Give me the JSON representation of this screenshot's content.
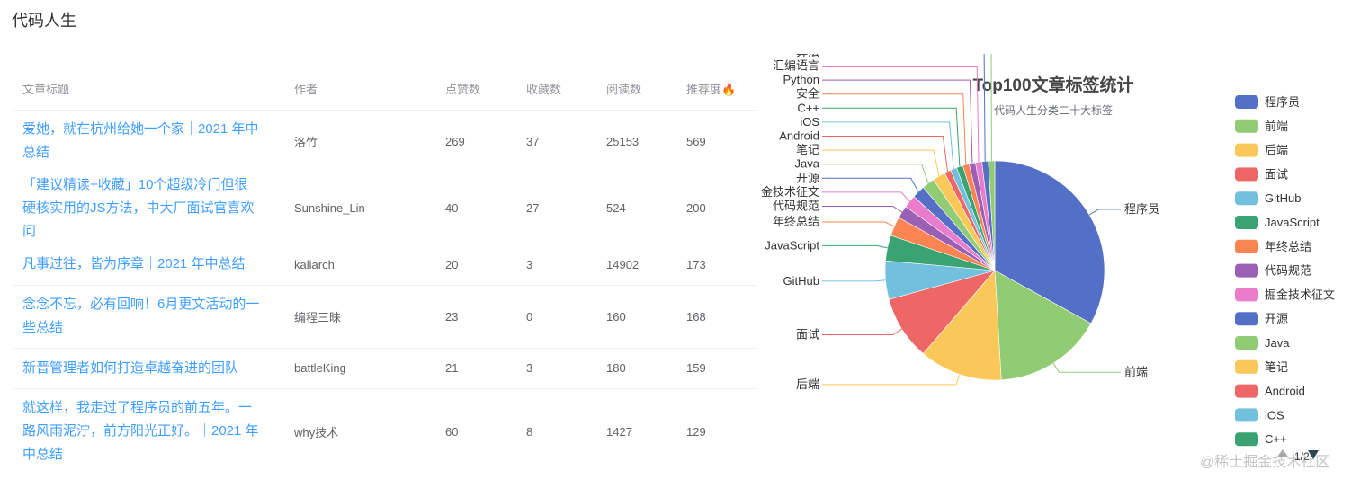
{
  "app": {
    "title": "代码人生"
  },
  "table": {
    "headers": [
      "文章标题",
      "作者",
      "点赞数",
      "收藏数",
      "阅读数",
      "推荐度🔥"
    ],
    "rows": [
      {
        "title": "爱她，就在杭州给她一个家｜2021 年中总结",
        "author": "洛竹",
        "likes": "269",
        "favorites": "37",
        "reads": "25153",
        "recommend": "569"
      },
      {
        "title": "「建议精读+收藏」10个超级冷门但很硬核实用的JS方法，中大厂面试官喜欢问",
        "author": "Sunshine_Lin",
        "likes": "40",
        "favorites": "27",
        "reads": "524",
        "recommend": "200"
      },
      {
        "title": "凡事过往，皆为序章｜2021 年中总结",
        "author": "kaliarch",
        "likes": "20",
        "favorites": "3",
        "reads": "14902",
        "recommend": "173"
      },
      {
        "title": "念念不忘，必有回响！6月更文活动的一些总结",
        "author": "编程三昧",
        "likes": "23",
        "favorites": "0",
        "reads": "160",
        "recommend": "168"
      },
      {
        "title": "新晋管理者如何打造卓越奋进的团队",
        "author": "battleKing",
        "likes": "21",
        "favorites": "3",
        "reads": "180",
        "recommend": "159"
      },
      {
        "title": "就这样，我走过了程序员的前五年。一路风雨泥泞，前方阳光正好。｜2021 年中总结",
        "author": "why技术",
        "likes": "60",
        "favorites": "8",
        "reads": "1427",
        "recommend": "129"
      }
    ]
  },
  "chart_data": {
    "type": "pie",
    "title": "Top100文章标签统计",
    "subtitle": "代码人生分类二十大标签",
    "categories": [
      "程序员",
      "前端",
      "后端",
      "面试",
      "GitHub",
      "JavaScript",
      "年终总结",
      "代码规范",
      "掘金技术征文",
      "开源",
      "Java",
      "笔记",
      "Android",
      "iOS",
      "C++",
      "安全",
      "Python",
      "汇编语言",
      "算法",
      "Flutter"
    ],
    "values": [
      35,
      17,
      13,
      10,
      6,
      4,
      3,
      2,
      2,
      2,
      2,
      2,
      1,
      1,
      1,
      1,
      1,
      1,
      1,
      1
    ],
    "colors": [
      "#5470c6",
      "#91cc75",
      "#fac858",
      "#ee6666",
      "#73c0de",
      "#3ba272",
      "#fc8452",
      "#9a60b4",
      "#ea7ccc",
      "#5470c6",
      "#91cc75",
      "#fac858",
      "#ee6666",
      "#73c0de",
      "#3ba272",
      "#fc8452",
      "#9a60b4",
      "#ea7ccc",
      "#5470c6",
      "#91cc75"
    ],
    "legend": {
      "position": "right",
      "visible_items": [
        "程序员",
        "前端",
        "后端",
        "面试",
        "GitHub",
        "JavaScript",
        "年终总结",
        "代码规范",
        "掘金技术征文",
        "开源",
        "Java",
        "笔记",
        "Android",
        "iOS",
        "C++"
      ],
      "page": "1/2"
    }
  },
  "watermark": "@稀土掘金技术社区"
}
